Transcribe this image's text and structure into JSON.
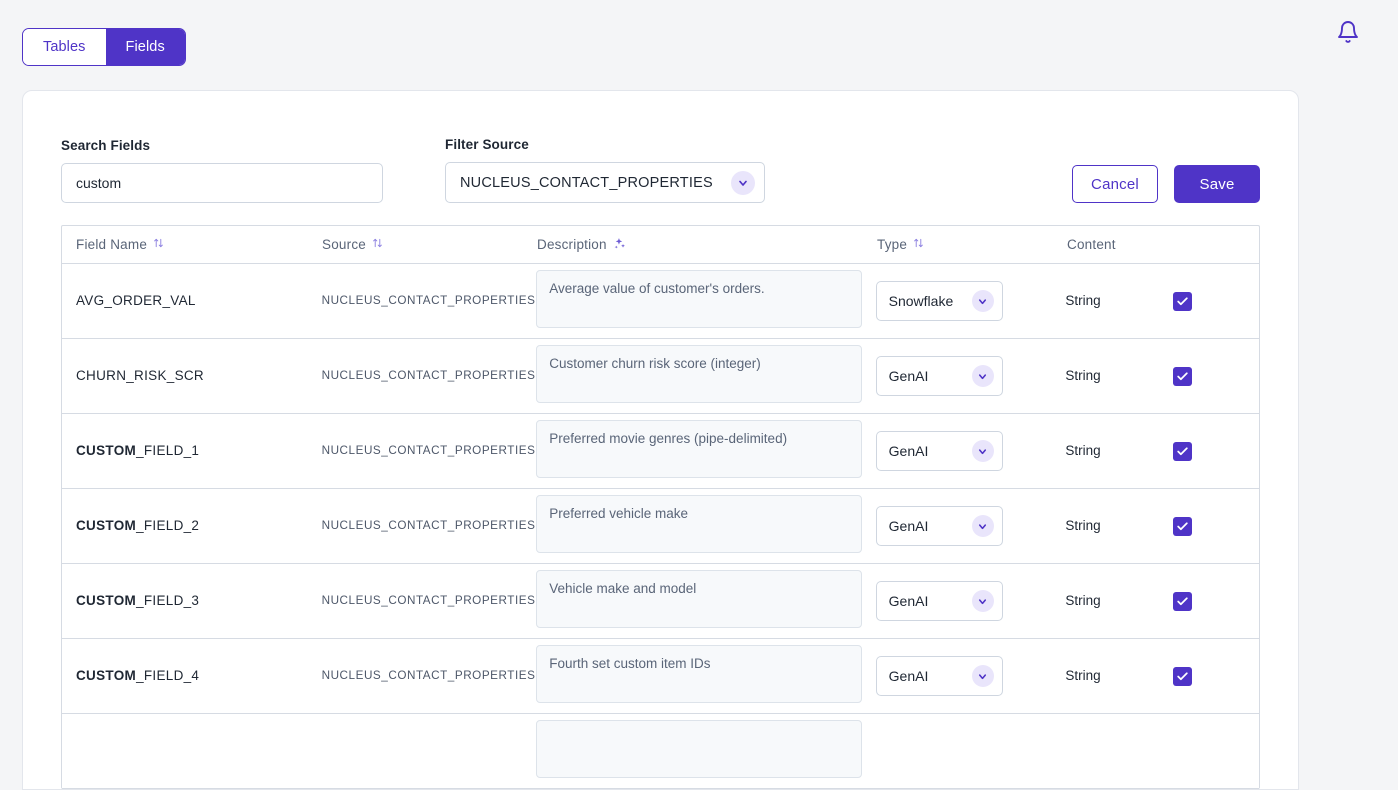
{
  "theme": {
    "accent": "#4f34c7",
    "accent_light": "#e9e5fb",
    "page_bg": "#f4f5f7",
    "border": "#d6dbe3",
    "muted_text": "#5a6578"
  },
  "topbar": {
    "tabs": [
      {
        "label": "Tables",
        "active": false
      },
      {
        "label": "Fields",
        "active": true
      }
    ],
    "notification_icon": "bell-icon"
  },
  "controls": {
    "search": {
      "label": "Search Fields",
      "value": "custom",
      "placeholder": "Search Fields"
    },
    "filter_source": {
      "label": "Filter Source",
      "value": "NUCLEUS_CONTACT_PROPERTIES"
    },
    "cancel_label": "Cancel",
    "save_label": "Save"
  },
  "table": {
    "headers": [
      {
        "label": "Field Name",
        "icon": "sort-icon"
      },
      {
        "label": "Source",
        "icon": "sort-icon"
      },
      {
        "label": "Description",
        "icon": "sparkles-icon"
      },
      {
        "label": "Type",
        "icon": "sort-icon"
      },
      {
        "label": "Content",
        "icon": null
      }
    ],
    "rows": [
      {
        "name_bold": "",
        "name_rest": "AVG_ORDER_VAL",
        "source": "NUCLEUS_CONTACT_PROPERTIES",
        "description": "Average value of customer's orders.",
        "type": "Snowflake",
        "field_type": "String",
        "content_checked": true
      },
      {
        "name_bold": "",
        "name_rest": "CHURN_RISK_SCR",
        "source": "NUCLEUS_CONTACT_PROPERTIES",
        "description": "Customer churn risk score (integer)",
        "type": "GenAI",
        "field_type": "String",
        "content_checked": true
      },
      {
        "name_bold": "CUSTOM",
        "name_rest": "_FIELD_1",
        "source": "NUCLEUS_CONTACT_PROPERTIES",
        "description": "Preferred movie genres (pipe-delimited)",
        "type": "GenAI",
        "field_type": "String",
        "content_checked": true
      },
      {
        "name_bold": "CUSTOM",
        "name_rest": "_FIELD_2",
        "source": "NUCLEUS_CONTACT_PROPERTIES",
        "description": "Preferred vehicle make",
        "type": "GenAI",
        "field_type": "String",
        "content_checked": true
      },
      {
        "name_bold": "CUSTOM",
        "name_rest": "_FIELD_3",
        "source": "NUCLEUS_CONTACT_PROPERTIES",
        "description": "Vehicle make and model",
        "type": "GenAI",
        "field_type": "String",
        "content_checked": true
      },
      {
        "name_bold": "CUSTOM",
        "name_rest": "_FIELD_4",
        "source": "NUCLEUS_CONTACT_PROPERTIES",
        "description": "Fourth set custom item IDs",
        "type": "GenAI",
        "field_type": "String",
        "content_checked": true
      },
      {
        "name_bold": "",
        "name_rest": "",
        "source": "",
        "description": "",
        "type": "",
        "field_type": "",
        "content_checked": false
      }
    ]
  }
}
